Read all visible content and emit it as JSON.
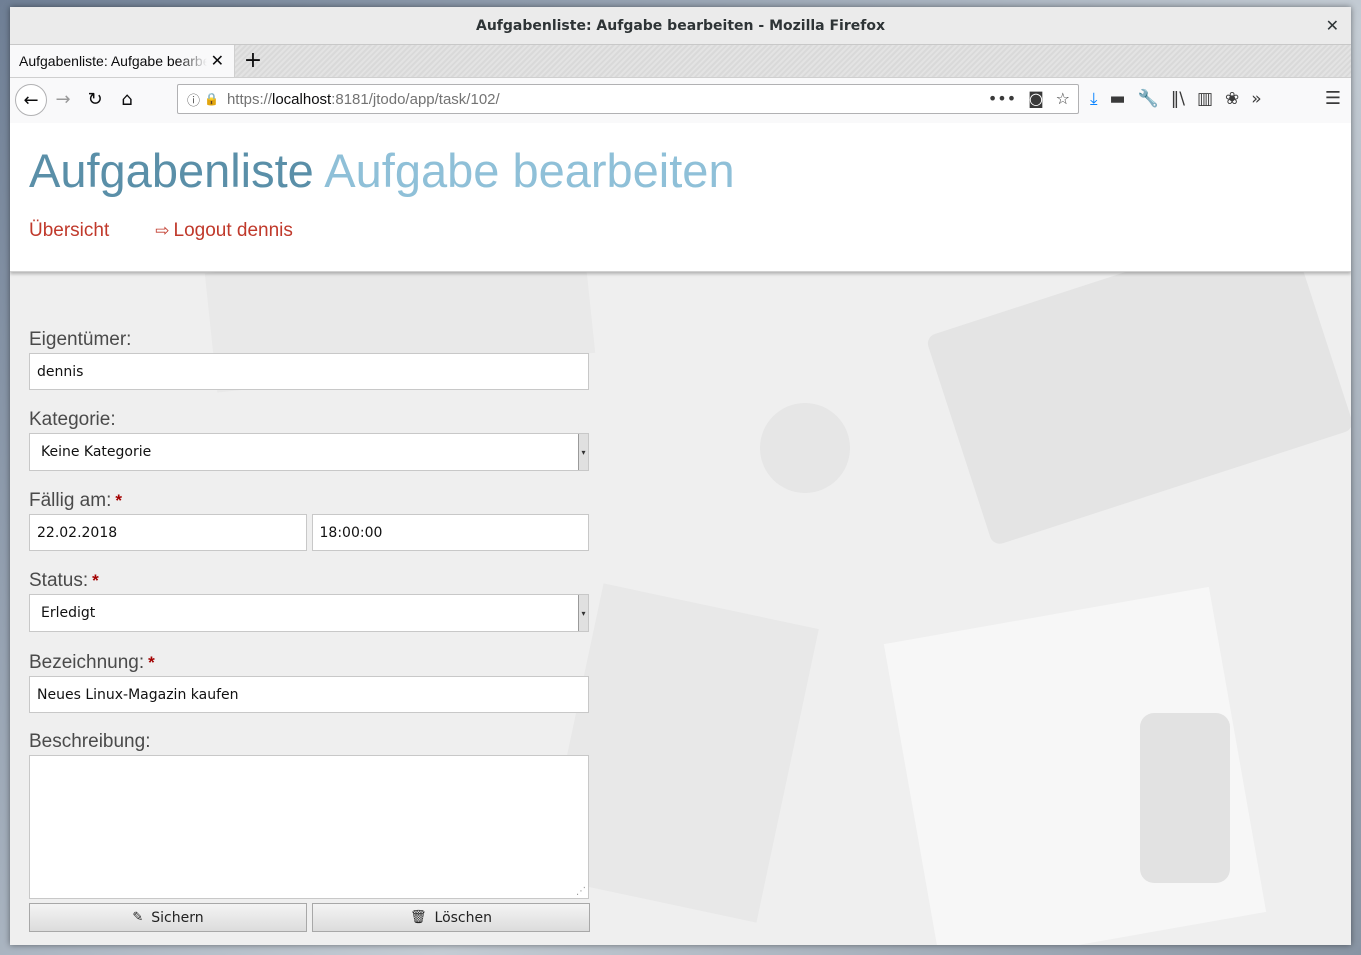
{
  "window": {
    "title": "Aufgabenliste: Aufgabe bearbeiten - Mozilla Firefox"
  },
  "tab": {
    "label": "Aufgabenliste: Aufgabe bearbeiten"
  },
  "url": {
    "scheme": "https://",
    "host": "localhost",
    "rest": ":8181/jtodo/app/task/102/"
  },
  "header": {
    "app_title": "Aufgabenliste",
    "page_title": "Aufgabe bearbeiten",
    "menu": {
      "overview": "Übersicht",
      "logout": "Logout dennis"
    }
  },
  "form": {
    "owner": {
      "label": "Eigentümer:",
      "value": "dennis"
    },
    "category": {
      "label": "Kategorie:",
      "value": "Keine Kategorie"
    },
    "due": {
      "label": "Fällig am:",
      "required": "*",
      "date": "22.02.2018",
      "time": "18:00:00"
    },
    "status": {
      "label": "Status:",
      "required": "*",
      "value": "Erledigt"
    },
    "title": {
      "label": "Bezeichnung:",
      "required": "*",
      "value": "Neues Linux-Magazin kaufen"
    },
    "description": {
      "label": "Beschreibung:",
      "value": ""
    },
    "save_label": "Sichern",
    "delete_label": "Löschen"
  },
  "colors": {
    "app_title": "#5a8fa8",
    "page_title": "#8fc0d8",
    "menu_link": "#c0392b",
    "required_marker": "#a30000"
  }
}
